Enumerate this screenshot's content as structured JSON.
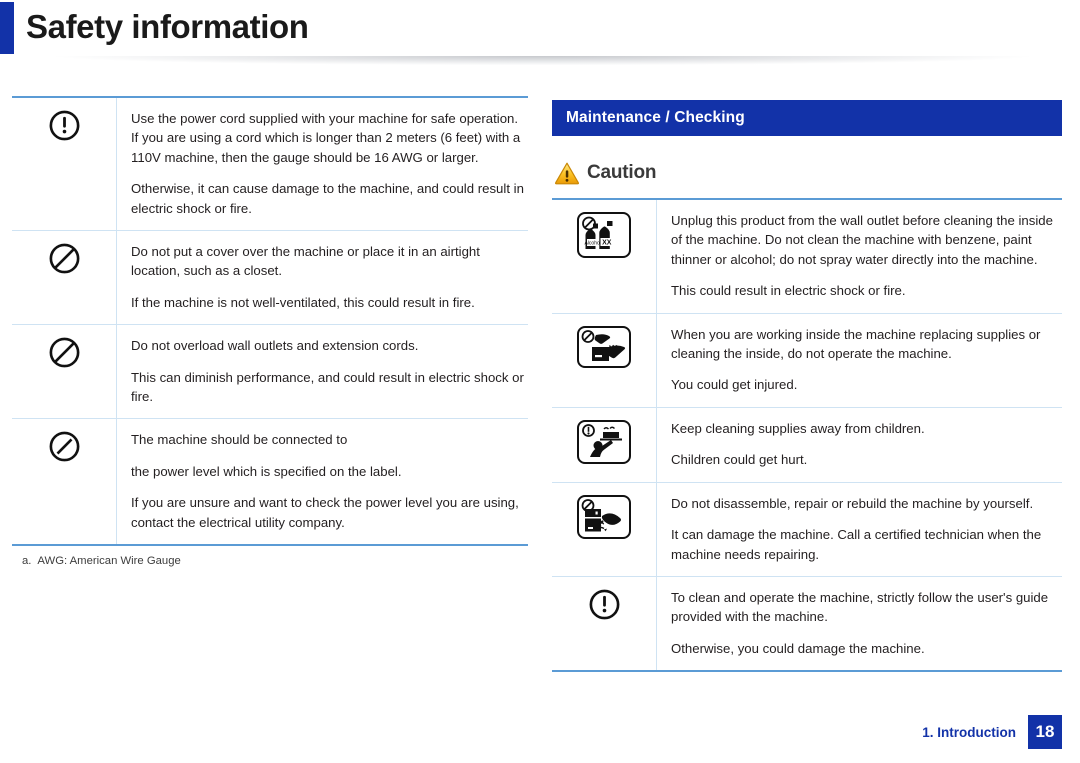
{
  "header": {
    "title": "Safety information",
    "accent_color": "#1232a8"
  },
  "left_column": {
    "rows": [
      {
        "icon": "exclamation-circle-icon",
        "paragraphs": [
          "Use the power cord supplied with your machine for safe operation. If you are using a cord which is longer than 2 meters (6 feet) with a 110V machine, then the gauge should be 16 AWG or larger.",
          "Otherwise, it can cause damage to the machine, and could result in electric shock or fire."
        ]
      },
      {
        "icon": "prohibition-circle-icon",
        "paragraphs": [
          "Do not put a cover over the machine or place it in an airtight location, such as a closet.",
          "If the machine is not well-ventilated, this could result in fire."
        ]
      },
      {
        "icon": "prohibition-circle-icon",
        "paragraphs": [
          "Do not overload wall outlets and extension cords.",
          "This can diminish performance, and could result in electric shock or fire."
        ]
      },
      {
        "icon": "slashed-circle-icon",
        "paragraphs": [
          "The machine should be connected to",
          "the power level which is specified on the label.",
          "If you are unsure and want to check the power level you are using, contact the electrical utility company."
        ]
      }
    ],
    "footnote_marker": "a.",
    "footnote_text": "AWG: American Wire Gauge"
  },
  "right_column": {
    "section_title": "Maintenance / Checking",
    "caution_label": "Caution",
    "caution_icon": "warning-triangle-icon",
    "rows": [
      {
        "icon": "no-solvents-bottles-icon",
        "icon_labels": [
          "Alcohol",
          "XX"
        ],
        "paragraphs": [
          "Unplug this product from the wall outlet before cleaning the inside of the machine. Do not clean the machine with benzene, paint thinner or alcohol; do not spray water directly into the machine.",
          "This could result in electric shock or fire."
        ]
      },
      {
        "icon": "no-hands-inside-machine-icon",
        "paragraphs": [
          "When you are working inside the machine replacing supplies or cleaning the inside, do not operate the machine.",
          "You could get injured."
        ]
      },
      {
        "icon": "keep-away-from-children-icon",
        "paragraphs": [
          "Keep cleaning supplies away from children.",
          "Children could get hurt."
        ]
      },
      {
        "icon": "no-disassembly-drill-icon",
        "paragraphs": [
          "Do not disassemble, repair or rebuild the machine by yourself.",
          "It can damage the machine. Call a certified technician when the machine needs repairing."
        ]
      },
      {
        "icon": "exclamation-circle-icon",
        "paragraphs": [
          "To clean and operate the machine, strictly follow the user's guide provided with the machine.",
          "Otherwise, you could damage the machine."
        ]
      }
    ]
  },
  "footer": {
    "chapter": "1. Introduction",
    "page_number": "18"
  }
}
